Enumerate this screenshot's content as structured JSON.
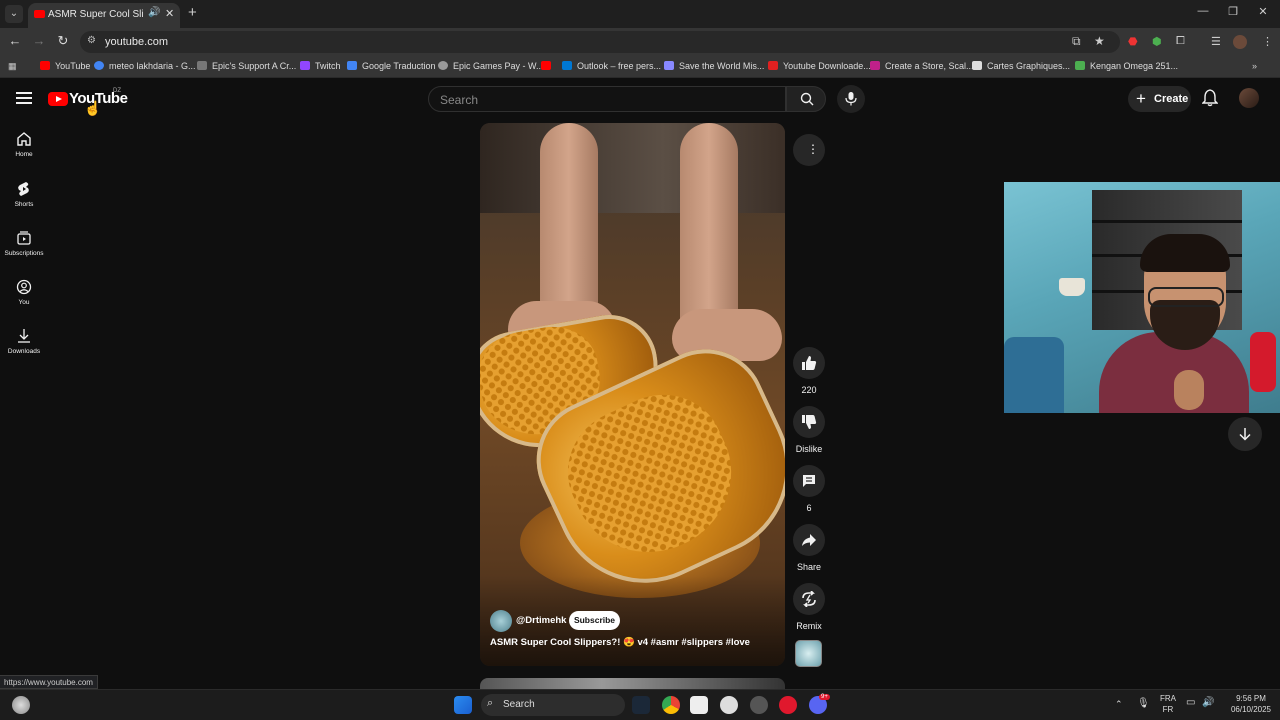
{
  "browser": {
    "tab": {
      "title": "ASMR Super Cool Slippers?!",
      "close": "✕",
      "audio": "🔊"
    },
    "new_tab": "+",
    "window": {
      "minimize": "—",
      "restore": "❐",
      "close": "✕"
    },
    "address": "youtube.com",
    "nav": {
      "back": "←",
      "forward": "→",
      "reload": "↻"
    },
    "bookmarks": [
      {
        "label": "YouTube",
        "color": "#ff0000"
      },
      {
        "label": "meteo lakhdaria - G...",
        "color": "#4285f4"
      },
      {
        "label": "Epic's Support A Cr...",
        "color": "#777777"
      },
      {
        "label": "Twitch",
        "color": "#9146ff"
      },
      {
        "label": "Google Traduction",
        "color": "#4285f4"
      },
      {
        "label": "Epic Games Pay - W...",
        "color": "#999999"
      },
      {
        "label": "",
        "color": "#ff0000"
      },
      {
        "label": "Outlook – free pers...",
        "color": "#0078d4"
      },
      {
        "label": "Save the World Mis...",
        "color": "#8888ff"
      },
      {
        "label": "Youtube Downloade...",
        "color": "#e02020"
      },
      {
        "label": "Create a Store, Scal...",
        "color": "#c0208a"
      },
      {
        "label": "Cartes Graphiques...",
        "color": "#dddddd"
      },
      {
        "label": "Kengan Omega 251...",
        "color": "#4caf50"
      }
    ],
    "status_url": "https://www.youtube.com"
  },
  "youtube": {
    "logo_text": "YouTube",
    "country_code": "DZ",
    "search_placeholder": "Search",
    "create_label": "Create",
    "sidebar": [
      {
        "label": "Home",
        "icon": "home-icon"
      },
      {
        "label": "Shorts",
        "icon": "shorts-icon"
      },
      {
        "label": "Subscriptions",
        "icon": "subscriptions-icon"
      },
      {
        "label": "You",
        "icon": "you-icon"
      },
      {
        "label": "Downloads",
        "icon": "download-icon"
      }
    ],
    "short": {
      "channel": "@Drtimehk",
      "subscribe_label": "Subscribe",
      "title": "ASMR Super Cool Slippers?! 😍 v4 #asmr #slippers #love"
    },
    "actions": {
      "like_count": "220",
      "dislike_label": "Dislike",
      "comment_count": "6",
      "share_label": "Share",
      "remix_label": "Remix"
    }
  },
  "taskbar": {
    "search_label": "Search",
    "language_top": "FRA",
    "language_bottom": "FR",
    "time": "9:56 PM",
    "date": "06/10/2025",
    "discord_badge": "9+"
  }
}
